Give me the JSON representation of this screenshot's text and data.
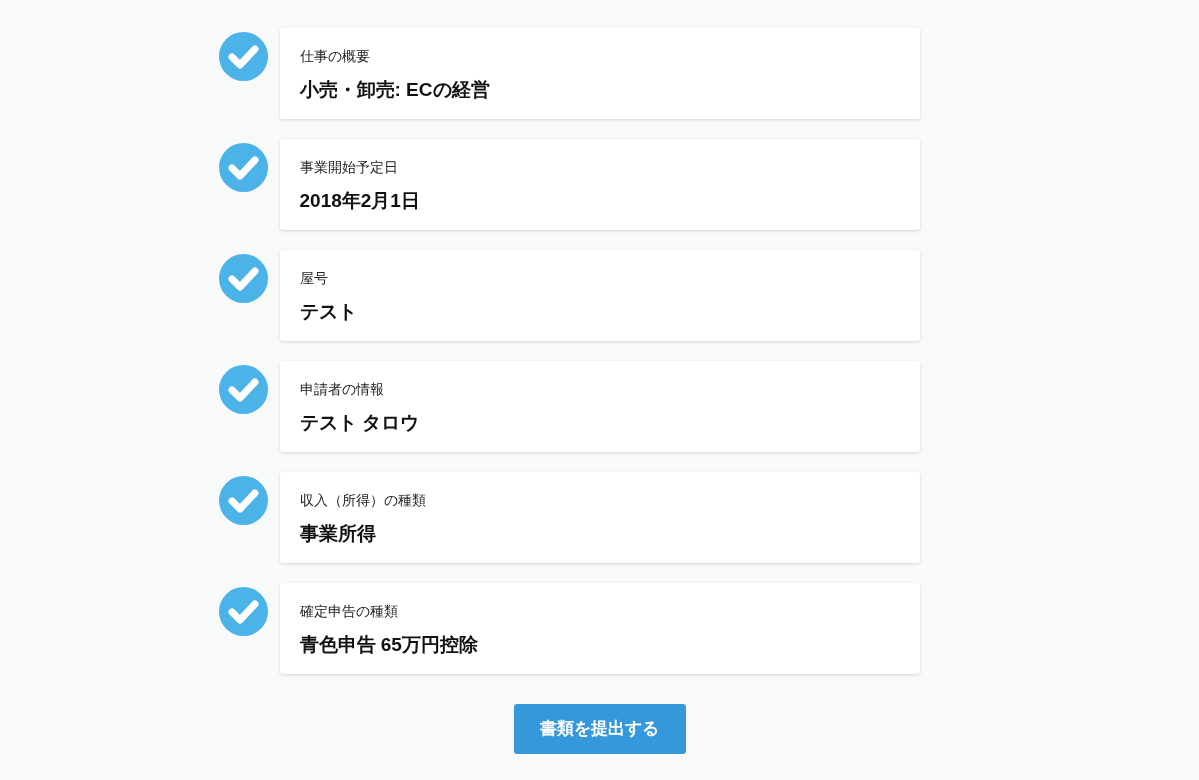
{
  "items": [
    {
      "label": "仕事の概要",
      "value": "小売・卸売: ECの経営",
      "completed": true
    },
    {
      "label": "事業開始予定日",
      "value": "2018年2月1日",
      "completed": true
    },
    {
      "label": "屋号",
      "value": "テスト",
      "completed": true
    },
    {
      "label": "申請者の情報",
      "value": "テスト タロウ",
      "completed": true
    },
    {
      "label": "収入（所得）の種類",
      "value": "事業所得",
      "completed": true
    },
    {
      "label": "確定申告の種類",
      "value": "青色申告 65万円控除",
      "completed": true
    }
  ],
  "submit_button": {
    "label": "書類を提出する"
  }
}
